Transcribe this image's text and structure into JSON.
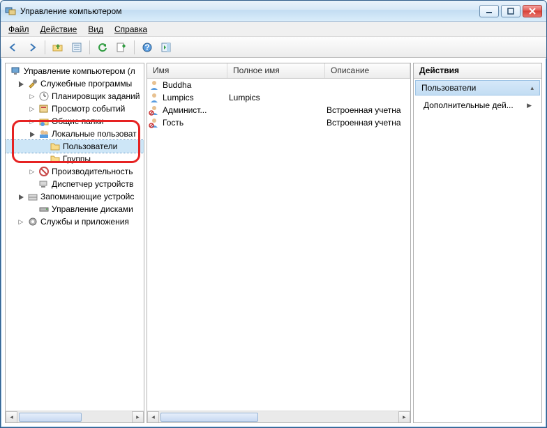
{
  "window": {
    "title": "Управление компьютером"
  },
  "menu": {
    "file": "Файл",
    "action": "Действие",
    "view": "Вид",
    "help": "Справка"
  },
  "tree": {
    "root": "Управление компьютером (л",
    "services": "Служебные программы",
    "scheduler": "Планировщик заданий",
    "events": "Просмотр событий",
    "shared": "Общие папки",
    "localusers": "Локальные пользоват",
    "users": "Пользователи",
    "groups": "Группы",
    "perf": "Производительность",
    "devmgr": "Диспетчер устройств",
    "storage": "Запоминающие устройс",
    "diskmgmt": "Управление дисками",
    "svcapps": "Службы и приложения"
  },
  "columns": {
    "name": "Имя",
    "fullname": "Полное имя",
    "desc": "Описание"
  },
  "users": [
    {
      "name": "Buddha",
      "fullname": "",
      "desc": ""
    },
    {
      "name": "Lumpics",
      "fullname": "Lumpics",
      "desc": ""
    },
    {
      "name": "Админист...",
      "fullname": "",
      "desc": "Встроенная учетна"
    },
    {
      "name": "Гость",
      "fullname": "",
      "desc": "Встроенная учетна"
    }
  ],
  "actions": {
    "header": "Действия",
    "subheader": "Пользователи",
    "more": "Дополнительные дей..."
  }
}
